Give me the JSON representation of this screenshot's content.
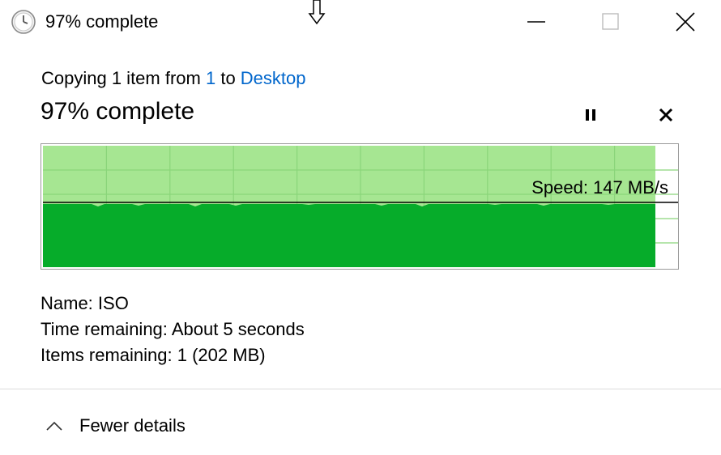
{
  "window": {
    "title": "97% complete",
    "title_icon": "clock-icon",
    "controls": [
      "minimize-icon",
      "maximize-icon",
      "close-icon"
    ]
  },
  "copy": {
    "prefix": "Copying 1 item from ",
    "source": "1",
    "middle": " to ",
    "destination": "Desktop"
  },
  "progress": {
    "heading": "97% complete",
    "percent": 97,
    "pause_icon": "pause-icon",
    "cancel_icon": "cancel-icon"
  },
  "graph": {
    "speed_label": "Speed: 147 MB/s",
    "colors": {
      "fill": "#06ac2a",
      "background_fill": "#a6e692",
      "grid": "#8ad57a",
      "line": "#000000"
    }
  },
  "details": {
    "name_label": "Name:",
    "name_value": "ISO",
    "time_label": "Time remaining:",
    "time_value": "About 5 seconds",
    "items_label": "Items remaining:",
    "items_value": "1 (202 MB)"
  },
  "footer": {
    "toggle_label": "Fewer details",
    "toggle_icon": "chevron-up-icon"
  }
}
